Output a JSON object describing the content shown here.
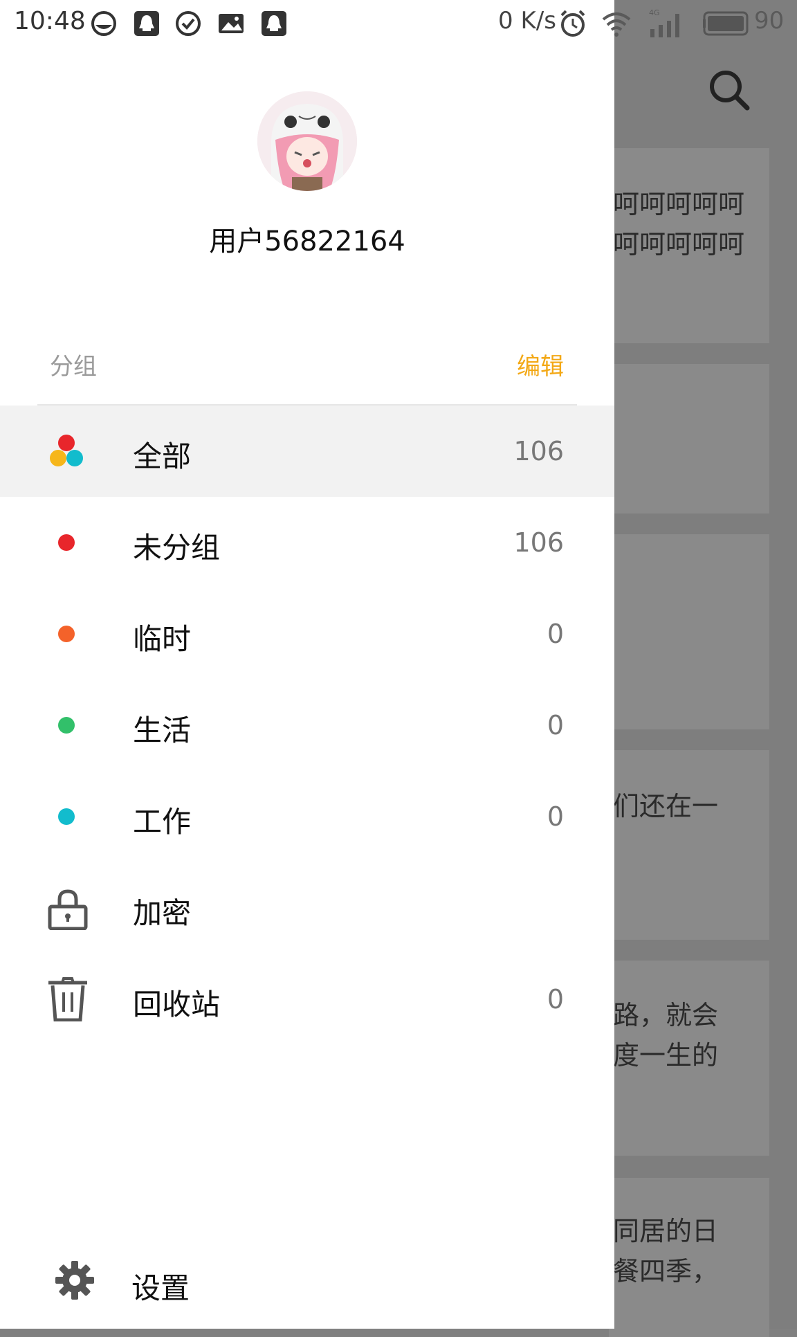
{
  "status_bar": {
    "time": "10:48",
    "net_speed": "0 K/s",
    "network": "4G",
    "battery": "90"
  },
  "background": {
    "card_texts": [
      [
        "呵呵呵呵呵",
        "呵呵呵呵呵"
      ],
      [],
      [],
      [
        "们还在一"
      ],
      [
        "路，就会",
        "度一生的"
      ],
      [
        "同居的日",
        "餐四季，"
      ]
    ]
  },
  "drawer": {
    "username": "用户56822164",
    "section_label": "分组",
    "edit_label": "编辑",
    "items": [
      {
        "label": "全部",
        "count": "106",
        "color": "multi"
      },
      {
        "label": "未分组",
        "count": "106",
        "color": "#e8262b"
      },
      {
        "label": "临时",
        "count": "0",
        "color": "#f4622a"
      },
      {
        "label": "生活",
        "count": "0",
        "color": "#32c06a"
      },
      {
        "label": "工作",
        "count": "0",
        "color": "#12bccd"
      },
      {
        "label": "加密",
        "count": "",
        "icon": "lock-icon"
      },
      {
        "label": "回收站",
        "count": "0",
        "icon": "trash-icon"
      }
    ],
    "settings_label": "设置"
  }
}
